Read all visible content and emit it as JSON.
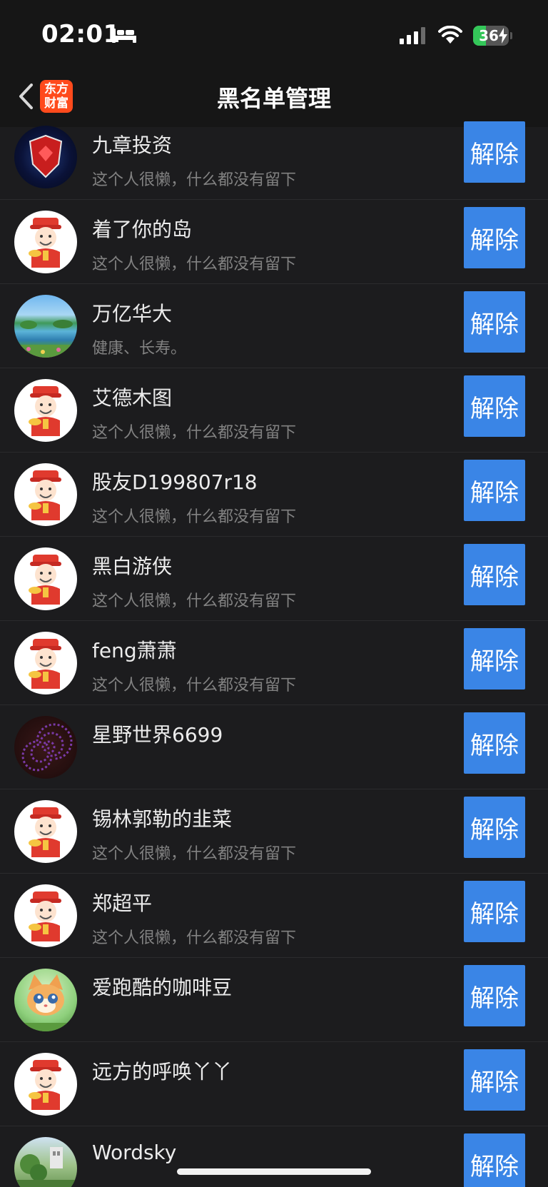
{
  "status_bar": {
    "time": "02:01",
    "battery_level": "36",
    "battery_fraction": 0.36,
    "icons": [
      "bed-icon",
      "signal-icon",
      "wifi-icon",
      "battery-icon",
      "charging-bolt-icon"
    ]
  },
  "nav": {
    "title": "黑名单管理",
    "logo_line1": "东方",
    "logo_line2": "财富",
    "back_icon": "chevron-left-icon"
  },
  "colors": {
    "background": "#1c1c1e",
    "button": "#3a85e6",
    "logo": "#ff4a1c",
    "battery_fill": "#34c759"
  },
  "list": {
    "button_label": "解除",
    "items": [
      {
        "name": "九章投资",
        "bio": "这个人很懒，什么都没有留下",
        "avatar": "shield-avatar"
      },
      {
        "name": "着了你的岛",
        "bio": "这个人很懒，什么都没有留下",
        "avatar": "caishen-avatar"
      },
      {
        "name": "万亿华大",
        "bio": "健康、长寿。",
        "avatar": "lake-avatar"
      },
      {
        "name": "艾德木图",
        "bio": "这个人很懒，什么都没有留下",
        "avatar": "caishen-avatar"
      },
      {
        "name": "股友D199807r18",
        "bio": "这个人很懒，什么都没有留下",
        "avatar": "caishen-avatar"
      },
      {
        "name": "黑白游侠",
        "bio": "这个人很懒，什么都没有留下",
        "avatar": "caishen-avatar"
      },
      {
        "name": "feng萧萧",
        "bio": "这个人很懒，什么都没有留下",
        "avatar": "caishen-avatar"
      },
      {
        "name": "星野世界6699",
        "bio": "",
        "avatar": "spiral-avatar"
      },
      {
        "name": "锡林郭勒的韭菜",
        "bio": "这个人很懒，什么都没有留下",
        "avatar": "caishen-avatar"
      },
      {
        "name": "郑超平",
        "bio": "这个人很懒，什么都没有留下",
        "avatar": "caishen-avatar"
      },
      {
        "name": "爱跑酷的咖啡豆",
        "bio": "",
        "avatar": "cat-avatar"
      },
      {
        "name": "远方的呼唤丫丫",
        "bio": "",
        "avatar": "caishen-avatar"
      },
      {
        "name": "Wordsky",
        "bio": "",
        "avatar": "garden-avatar"
      }
    ]
  }
}
